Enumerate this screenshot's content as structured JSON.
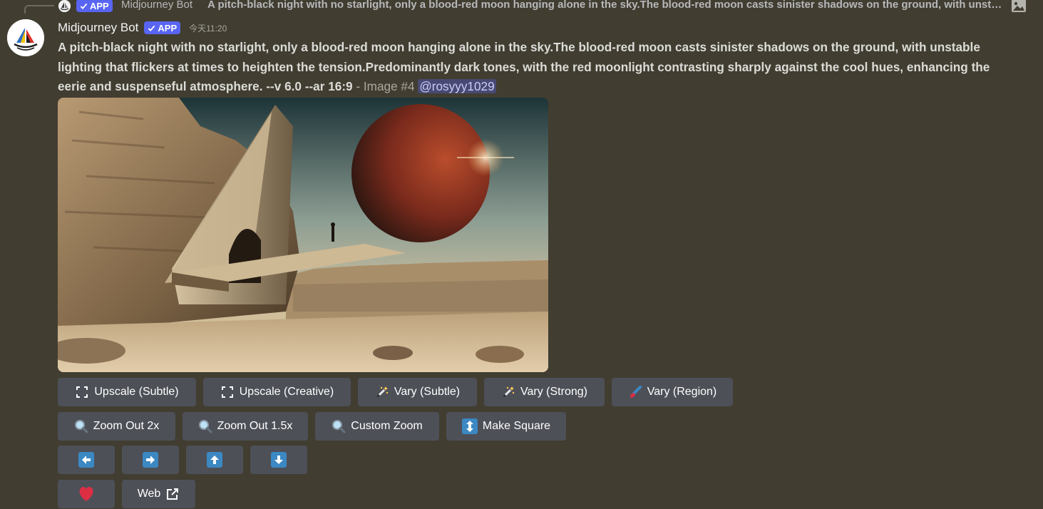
{
  "reply": {
    "badge": "APP",
    "author": "Midjourney Bot",
    "text": "A pitch-black night with no starlight, only a blood-red moon hanging alone in the sky.The blood-red moon casts sinister shadows on the ground, with unstable lighting that flickers at times to heighten the tension.Predominantly dark tones, with the red moonlight contrasting sharply against the cool hues, enhancing the eerie and suspenseful atmosphere. --v 6.0 --ar 16:9"
  },
  "message": {
    "author": "Midjourney Bot",
    "badge": "APP",
    "timestamp": "今天11:20",
    "prompt": "A pitch-black night with no starlight, only a blood-red moon hanging alone in the sky.The blood-red moon casts sinister shadows on the ground, with unstable lighting that flickers at times to heighten the tension.Predominantly dark tones, with the red moonlight contrasting sharply against the cool hues, enhancing the eerie and suspenseful atmosphere. --v 6.0 --ar 16:9",
    "suffix": " - Image #4 ",
    "mention": "@rosyyy1029"
  },
  "buttons": {
    "upscale_subtle": "Upscale (Subtle)",
    "upscale_creative": "Upscale (Creative)",
    "vary_subtle": "Vary (Subtle)",
    "vary_strong": "Vary (Strong)",
    "vary_region": "Vary (Region)",
    "zoom_out_2x": "Zoom Out 2x",
    "zoom_out_1_5x": "Zoom Out 1.5x",
    "custom_zoom": "Custom Zoom",
    "make_square": "Make Square",
    "web": "Web"
  },
  "icons": {
    "upscale": "expand-icon",
    "vary": "magic-wand-icon",
    "vary_region": "paintbrush-icon",
    "zoom": "magnifier-icon",
    "make_square": "up-down-arrow-icon",
    "pan": [
      "arrow-left-icon",
      "arrow-right-icon",
      "arrow-up-icon",
      "arrow-down-icon"
    ],
    "favorite": "heart-icon",
    "web": "external-link-icon"
  },
  "colors": {
    "background": "#413d31",
    "button": "#4e5058",
    "badge": "#5865f2",
    "arrow": "#3b88c3",
    "heart": "#dd2e44"
  }
}
